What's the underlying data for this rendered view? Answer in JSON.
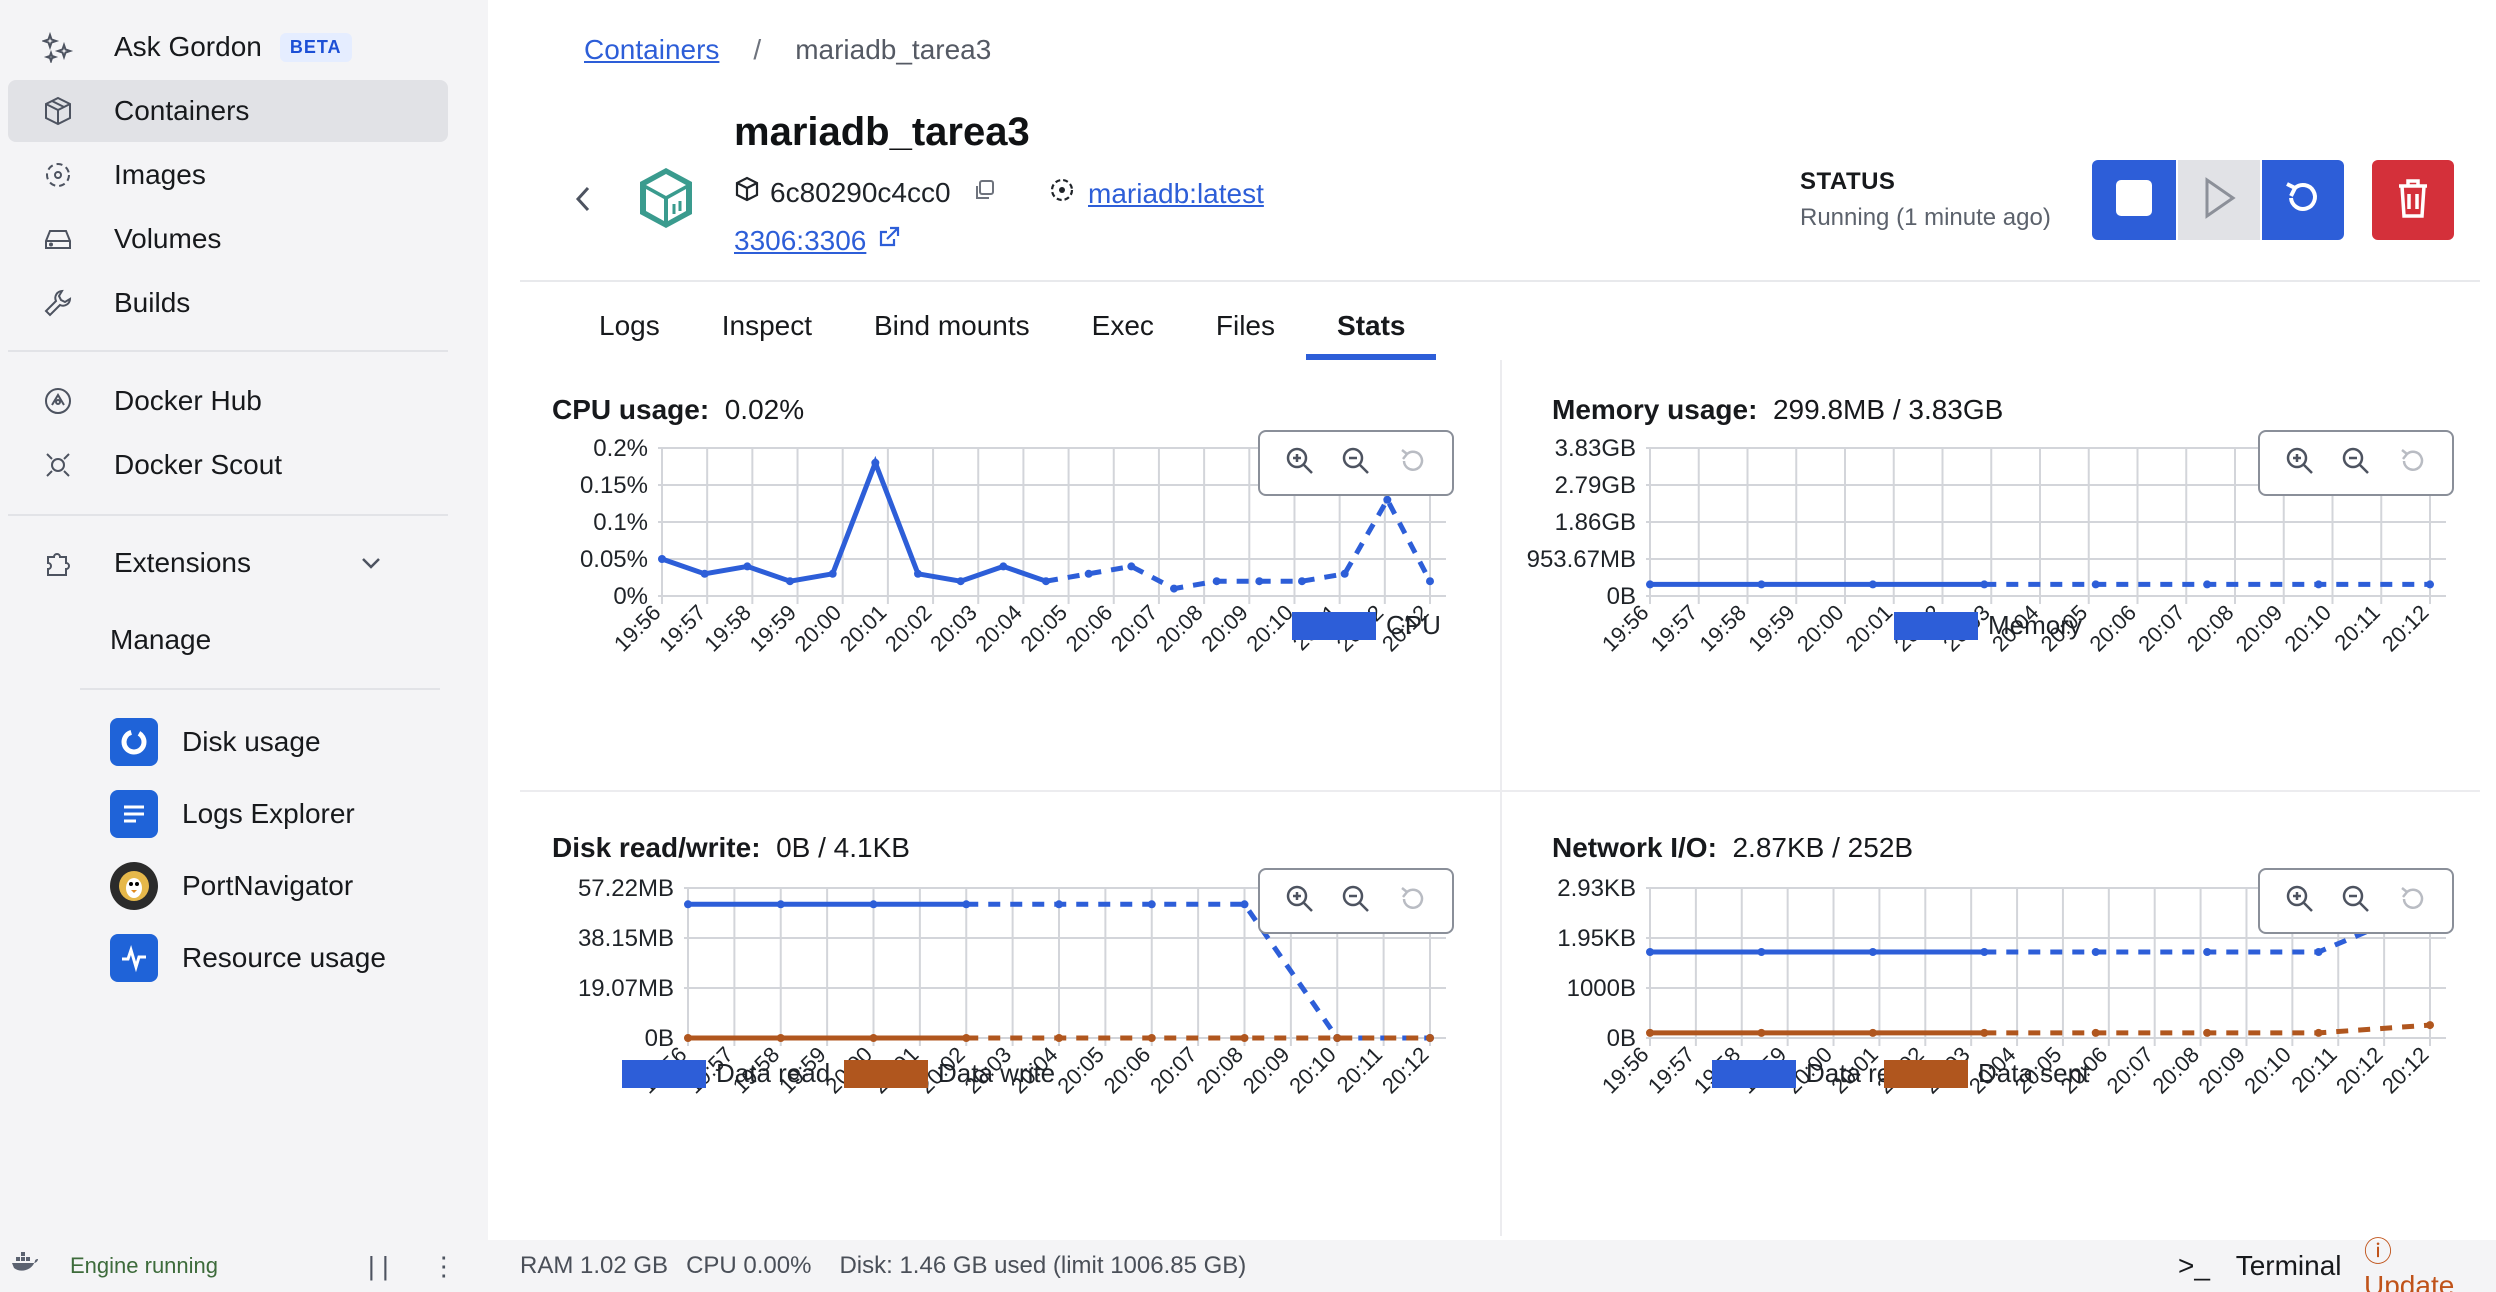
{
  "sidebar": {
    "items": [
      {
        "label": "Ask Gordon",
        "icon": "sparkle-icon",
        "badge": "BETA"
      },
      {
        "label": "Containers",
        "icon": "container-icon"
      },
      {
        "label": "Images",
        "icon": "image-icon"
      },
      {
        "label": "Volumes",
        "icon": "volume-icon"
      },
      {
        "label": "Builds",
        "icon": "wrench-icon"
      },
      {
        "label": "Docker Hub",
        "icon": "hub-icon"
      },
      {
        "label": "Docker Scout",
        "icon": "scout-icon"
      }
    ],
    "extensions_label": "Extensions",
    "manage_label": "Manage",
    "extensions": [
      {
        "label": "Disk usage",
        "icon": "disk-usage-icon",
        "color": "#1f63d8"
      },
      {
        "label": "Logs Explorer",
        "icon": "logs-explorer-icon",
        "color": "#1f63d8"
      },
      {
        "label": "PortNavigator",
        "icon": "portnavigator-icon",
        "color": "#2b2b2b"
      },
      {
        "label": "Resource usage",
        "icon": "resource-usage-icon",
        "color": "#1f63d8"
      }
    ],
    "engine_status": "Engine running"
  },
  "breadcrumb": {
    "root": "Containers",
    "sep": "/",
    "current": "mariadb_tarea3"
  },
  "container": {
    "name": "mariadb_tarea3",
    "id": "6c80290c4cc0",
    "image": "mariadb:latest",
    "port": "3306:3306"
  },
  "status": {
    "label": "STATUS",
    "value": "Running (1 minute ago)"
  },
  "tabs": [
    "Logs",
    "Inspect",
    "Bind mounts",
    "Exec",
    "Files",
    "Stats"
  ],
  "active_tab": "Stats",
  "stats": {
    "cpu": {
      "title": "CPU usage:",
      "value": "0.02%"
    },
    "memory": {
      "title": "Memory usage:",
      "value": "299.8MB / 3.83GB"
    },
    "disk": {
      "title": "Disk read/write:",
      "value": "0B / 4.1KB"
    },
    "network": {
      "title": "Network I/O:",
      "value": "2.87KB / 252B"
    }
  },
  "colors": {
    "blue": "#2d5ed8",
    "orange": "#b0561e",
    "grid": "#d3d5da"
  },
  "chart_data": [
    {
      "type": "line",
      "x": [
        "19:56",
        "19:57",
        "19:58",
        "19:59",
        "20:00",
        "20:01",
        "20:02",
        "20:03",
        "20:04",
        "20:05",
        "20:06",
        "20:07",
        "20:08",
        "20:09",
        "20:10",
        "20:11",
        "20:12",
        "20:12"
      ],
      "ytick_labels": [
        "0.2%",
        "0.15%",
        "0.1%",
        "0.05%",
        "0%"
      ],
      "ylim": [
        0,
        0.2
      ],
      "series": [
        {
          "name": "CPU",
          "color": "#2d5ed8",
          "values": [
            0.05,
            0.03,
            0.04,
            0.02,
            0.03,
            0.18,
            0.03,
            0.02,
            0.04,
            0.02,
            0.03,
            0.04,
            0.01,
            0.02,
            0.02,
            0.02,
            0.03,
            0.13,
            0.02
          ]
        }
      ],
      "legend": "bottom-right"
    },
    {
      "type": "line",
      "x": [
        "19:56",
        "19:57",
        "19:58",
        "19:59",
        "20:00",
        "20:01",
        "20:02",
        "20:03",
        "20:04",
        "20:05",
        "20:06",
        "20:07",
        "20:08",
        "20:09",
        "20:10",
        "20:11",
        "20:12"
      ],
      "ytick_labels": [
        "3.83GB",
        "2.79GB",
        "1.86GB",
        "953.67MB",
        "0B"
      ],
      "series": [
        {
          "name": "Memory",
          "color": "#2d5ed8",
          "values_mb": [
            299.8,
            299.8,
            299.8,
            299.8,
            299.8,
            299.8,
            299.8,
            299.8
          ]
        }
      ],
      "legend": "bottom-right"
    },
    {
      "type": "line",
      "x": [
        "19:56",
        "19:57",
        "19:58",
        "19:59",
        "20:00",
        "20:01",
        "20:02",
        "20:03",
        "20:04",
        "20:05",
        "20:06",
        "20:07",
        "20:08",
        "20:09",
        "20:10",
        "20:11",
        "20:12"
      ],
      "ytick_labels": [
        "57.22MB",
        "38.15MB",
        "19.07MB",
        "0B"
      ],
      "series": [
        {
          "name": "Data read",
          "color": "#2d5ed8",
          "values_mb": [
            51,
            51,
            51,
            51,
            51,
            51,
            51,
            0,
            0
          ]
        },
        {
          "name": "Data write",
          "color": "#b0561e",
          "values_mb": [
            0,
            0,
            0,
            0,
            0,
            0,
            0,
            0,
            0
          ]
        }
      ],
      "legend": "bottom-right"
    },
    {
      "type": "line",
      "x": [
        "19:56",
        "19:57",
        "19:58",
        "19:59",
        "20:00",
        "20:01",
        "20:02",
        "20:03",
        "20:04",
        "20:05",
        "20:06",
        "20:07",
        "20:08",
        "20:09",
        "20:10",
        "20:11",
        "20:12",
        "20:12"
      ],
      "ytick_labels": [
        "2.93KB",
        "1.95KB",
        "1000B",
        "0B"
      ],
      "series": [
        {
          "name": "Data received",
          "color": "#2d5ed8",
          "values_b": [
            1680,
            1680,
            1680,
            1680,
            1680,
            1680,
            1680,
            2600
          ]
        },
        {
          "name": "Data sent",
          "color": "#b0561e",
          "values_b": [
            100,
            100,
            100,
            100,
            100,
            100,
            100,
            252
          ]
        }
      ],
      "legend": "bottom-right"
    }
  ],
  "footer": {
    "ram": "RAM 1.02 GB",
    "cpu": "CPU 0.00%",
    "disk": "Disk: 1.46 GB used (limit 1006.85 GB)",
    "terminal": "Terminal",
    "update": "Update"
  }
}
